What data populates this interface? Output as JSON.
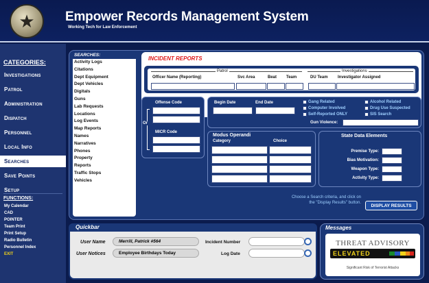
{
  "header": {
    "title": "Empower Records Management System",
    "subtitle": "Working Tech for Law Enforcement"
  },
  "nav": {
    "categories_label": "CATEGORIES:",
    "items": [
      "Investigations",
      "Patrol",
      "Administration",
      "Dispatch",
      "Personnel",
      "Local Info",
      "Searches",
      "Save Points",
      "Setup"
    ],
    "active": "Searches",
    "functions_label": "FUNCTIONS:",
    "functions": [
      "My Calendar",
      "CAD",
      "POINTER",
      "Team Print",
      "Print Setup",
      "Radio Bulletin",
      "Personnel Index",
      "EXIT"
    ]
  },
  "searches": {
    "label": "SEARCHES:",
    "items": [
      "Activity Logs",
      "Citations",
      "Dept Equipment",
      "Dept Vehicles",
      "Digitals",
      "Guns",
      "Lab Requests",
      "Locations",
      "Log Events",
      "Map Reports",
      "Names",
      "Narratives",
      "Phones",
      "Property",
      "Reports",
      "Traffic Stops",
      "Vehicles"
    ]
  },
  "incident": {
    "title": "INCIDENT REPORTS",
    "patrol_label": "Patrol",
    "investigations_label": "Investigations",
    "columns": [
      "Officer Name (Reporting)",
      "Svc Area",
      "Beat",
      "Team",
      "DU Team",
      "Investigator Assigned"
    ],
    "offense_code": "Offense Code",
    "or_label": "Or",
    "micr_code": "MICR Code",
    "begin_date": "Begin Date",
    "end_date": "End Date",
    "checkboxes": [
      "Gang Related",
      "Alcohol Related",
      "Computer Involved",
      "Drug Use Suspected",
      "Self-Reported ONLY",
      "SIS Search"
    ],
    "gun_violence": "Gun Violence:",
    "modus_operandi": "Modus Operandi",
    "category": "Category",
    "choice": "Choice",
    "state_data": "State Data Elements",
    "state_fields": [
      "Premise Type:",
      "Bias Motivation:",
      "Weapon Type:",
      "Activity Type:"
    ],
    "instructions": "Choose a Search criteria, and click on the \"Display Results\" button.",
    "display_button": "DISPLAY RESULTS"
  },
  "quickbar": {
    "title": "Quickbar",
    "user_name_label": "User Name",
    "user_name_value": "Merrill, Patrick  #564",
    "user_notices_label": "User Notices",
    "user_notices_value": "Employee Birthdays Today",
    "incident_number_label": "Incident Number",
    "log_date_label": "Log Date"
  },
  "messages": {
    "title": "Messages",
    "advisory_title": "THREAT ADVISORY",
    "advisory_level": "ELEVATED",
    "advisory_text": "Significant Risk of Terrorist Attacks",
    "colors": [
      "#1a8a2c",
      "#2a57c2",
      "#f2d31a",
      "#f08a1a",
      "#d8261d"
    ]
  }
}
